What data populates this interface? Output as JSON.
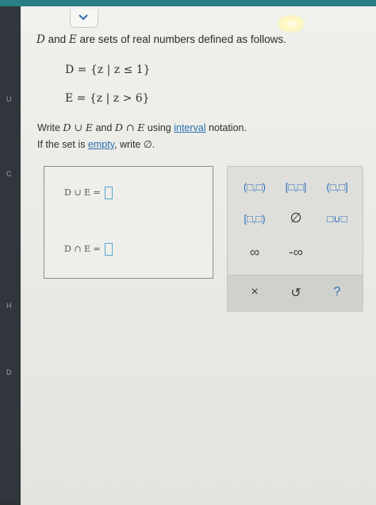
{
  "prompt": {
    "text_pre": "D",
    "text_mid": " and ",
    "text_e": "E",
    "text_post": " are sets of real numbers defined as follows."
  },
  "sets": {
    "d_def": "D = {z | z ≤ 1}",
    "e_def": "E = {z | z > 6}"
  },
  "instructions": {
    "line1_pre": "Write ",
    "line1_union": "D ∪ E",
    "line1_and": " and ",
    "line1_inter": "D ∩ E",
    "line1_using": " using ",
    "interval_link": "interval",
    "line1_post": " notation.",
    "line2_pre": "If the set is ",
    "empty_link": "empty",
    "line2_post": ", write ∅."
  },
  "answers": {
    "union_label": "D ∪ E =",
    "intersection_label": "D ∩ E ="
  },
  "keypad": {
    "open_open": "(□,□)",
    "closed_closed": "[□,□]",
    "open_closed": "(□,□]",
    "closed_open": "[□,□)",
    "empty_set": "∅",
    "union": "□∪□",
    "infinity": "∞",
    "neg_infinity": "-∞",
    "clear": "×",
    "undo": "↺",
    "help": "?"
  },
  "edge_marks": [
    "U",
    "C",
    "H",
    "D"
  ]
}
